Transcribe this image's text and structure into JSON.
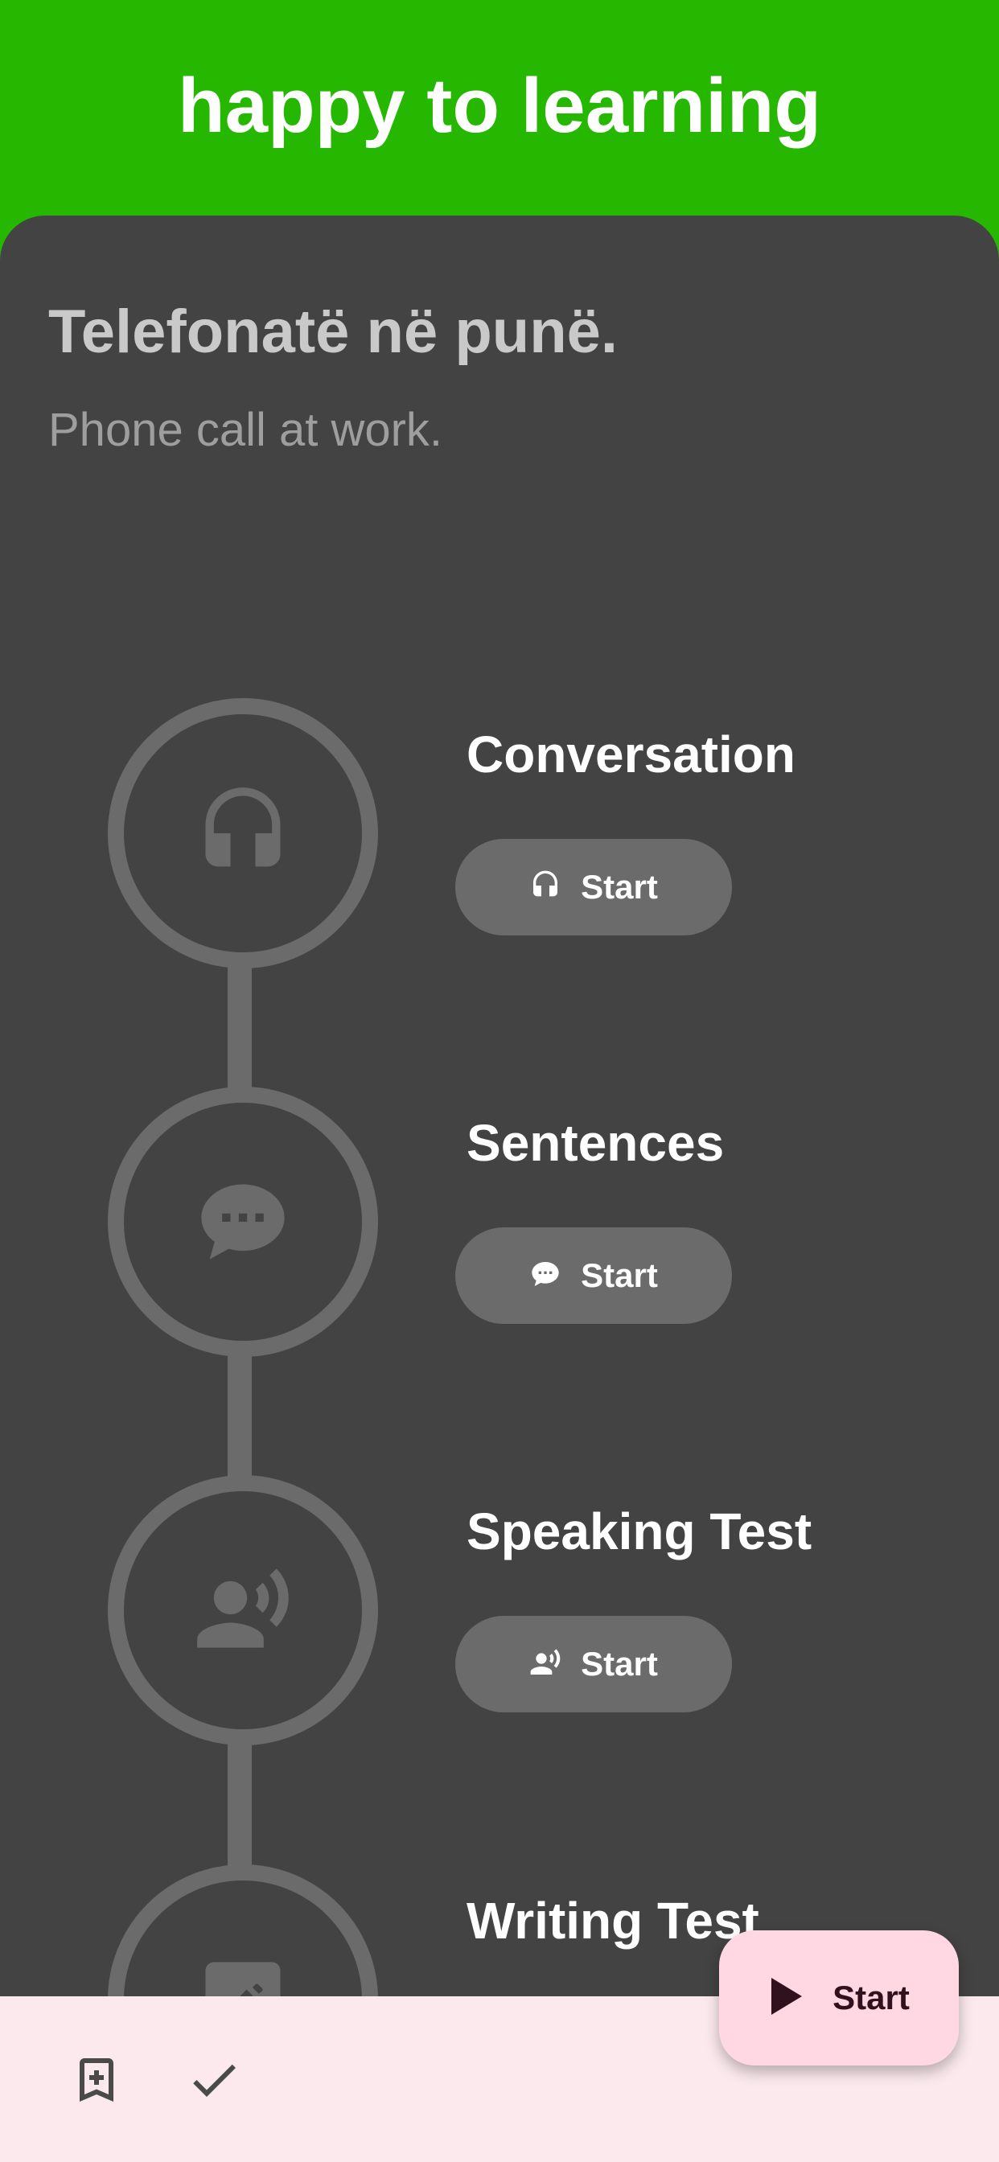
{
  "header": {
    "title": "happy to learning"
  },
  "lesson": {
    "title": "Telefonatë në punë.",
    "subtitle": "Phone call at work."
  },
  "steps": [
    {
      "label": "Conversation",
      "button": "Start",
      "icon": "headphones-icon"
    },
    {
      "label": "Sentences",
      "button": "Start",
      "icon": "chat-bubble-icon"
    },
    {
      "label": "Speaking Test",
      "button": "Start",
      "icon": "voice-person-icon"
    },
    {
      "label": "Writing Test",
      "icon": "edit-note-icon"
    }
  ],
  "bottom_bar": {
    "icons": [
      "bookmark-add-icon",
      "check-icon"
    ]
  },
  "fab": {
    "label": "Start",
    "icon": "play-icon"
  },
  "colors": {
    "header": "#26b800",
    "panel": "#434343",
    "step_outline": "#6b6b6b",
    "bottom_bar": "#fbe9ee",
    "fab": "#ffd8e4"
  }
}
